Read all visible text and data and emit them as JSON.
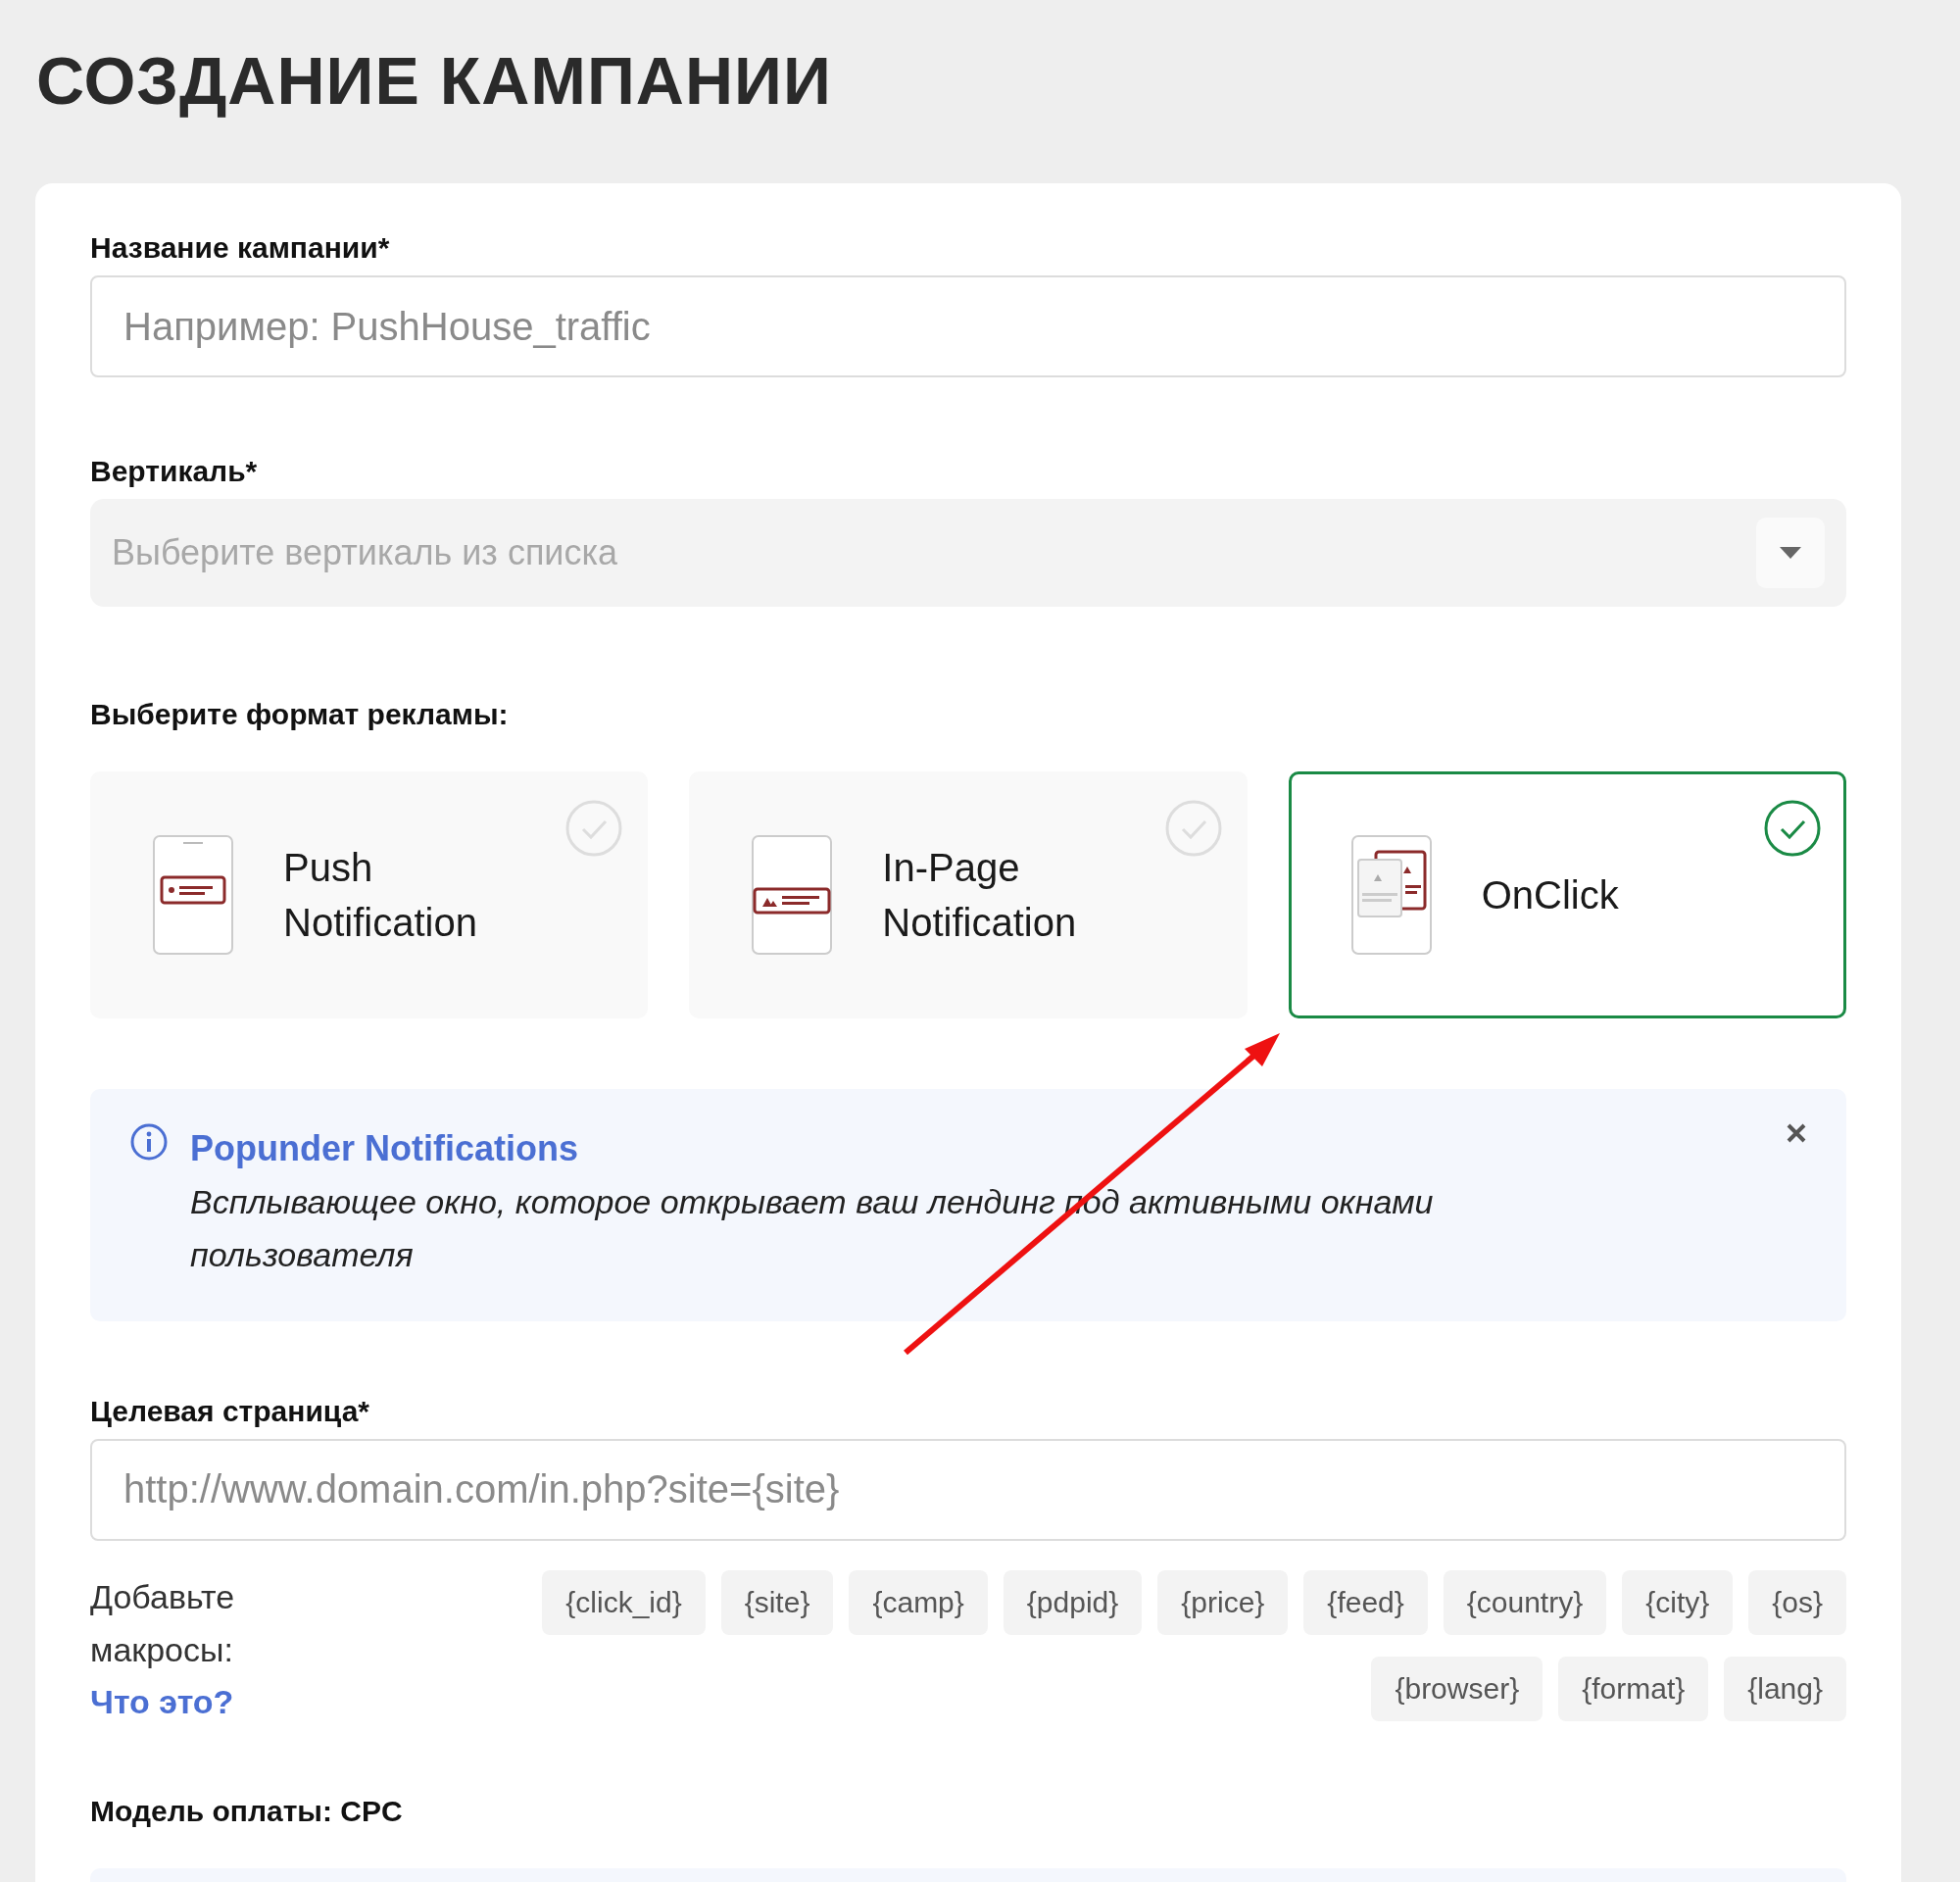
{
  "page_title": "СОЗДАНИЕ КАМПАНИИ",
  "campaign_name": {
    "label": "Название кампании*",
    "placeholder": "Например: PushHouse_traffic"
  },
  "vertical": {
    "label": "Вертикаль*",
    "placeholder": "Выберите вертикаль из списка"
  },
  "ad_format": {
    "label": "Выберите формат рекламы:",
    "options": [
      {
        "kind": "push",
        "label": "Push Notification",
        "selected": false
      },
      {
        "kind": "inpage",
        "label": "In-Page Notification",
        "selected": false
      },
      {
        "kind": "onclick",
        "label": "OnClick",
        "selected": true
      }
    ]
  },
  "info": {
    "title": "Popunder Notifications",
    "text": "Всплывающее окно, которое открывает ваш лендинг под активными окнами пользователя"
  },
  "target_page": {
    "label": "Целевая страница*",
    "placeholder": "http://www.domain.com/in.php?site={site}"
  },
  "macros": {
    "label": "Добавьте макросы:",
    "help_link": "Что это?",
    "items": [
      "{click_id}",
      "{site}",
      "{camp}",
      "{pdpid}",
      "{price}",
      "{feed}",
      "{country}",
      "{city}",
      "{os}",
      "{browser}",
      "{format}",
      "{lang}"
    ]
  },
  "payment_model": {
    "label": "Модель оплаты: CPC"
  }
}
